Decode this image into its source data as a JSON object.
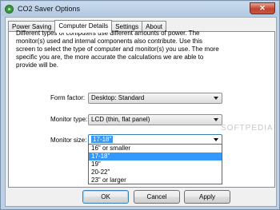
{
  "window": {
    "title": "CO2 Saver Options",
    "close_label": "✕"
  },
  "tabs": [
    {
      "label": "Power Saving",
      "active": false
    },
    {
      "label": "Computer Details",
      "active": true
    },
    {
      "label": "Settings",
      "active": false
    },
    {
      "label": "About",
      "active": false
    }
  ],
  "description": [
    "Different types of computers use different amounts of power.  The",
    "monitor(s) used and internal components also contribute.  Use this",
    "screen to select the type of computer and monitor(s) you use.  The more",
    "specific you are, the more accurate the calculations we are able to",
    "provide will be."
  ],
  "form": {
    "form_factor": {
      "label": "Form factor:",
      "value": "Desktop: Standard"
    },
    "monitor_type": {
      "label": "Monitor type:",
      "value": "LCD (thin, flat panel)"
    },
    "monitor_size": {
      "label": "Monitor size:",
      "value": "17-18\"",
      "open": true,
      "options": [
        "16\" or smaller",
        "17-18\"",
        "19\"",
        "20-22\"",
        "23\" or larger"
      ],
      "selected_index": 1
    }
  },
  "buttons": {
    "ok": "OK",
    "cancel": "Cancel",
    "apply": "Apply"
  },
  "watermark": "SOFTPEDIA"
}
